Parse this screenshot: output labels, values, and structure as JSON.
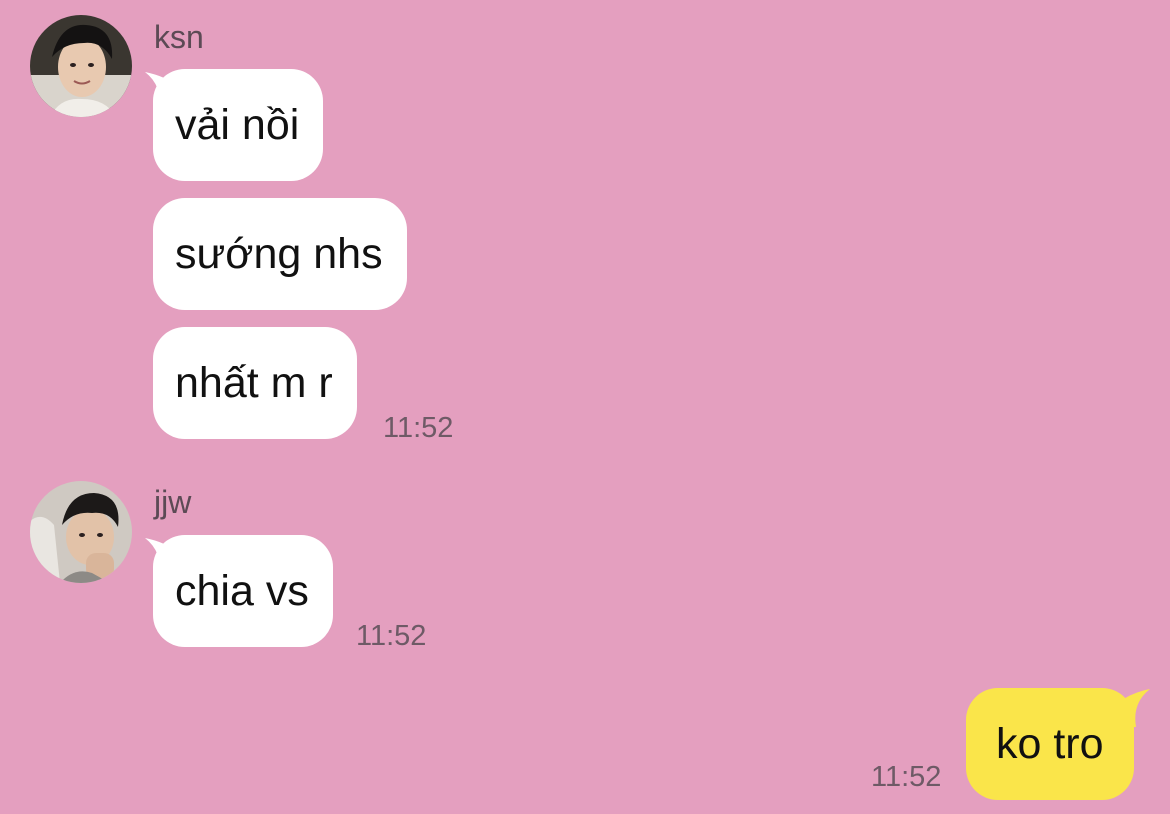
{
  "colors": {
    "background": "#e49fbf",
    "incoming_bubble": "#ffffff",
    "outgoing_bubble": "#fae54a",
    "secondary_text": "#6e5a66"
  },
  "groups": [
    {
      "sender": "ksn",
      "avatar_icon": "profile-photo-avatar",
      "messages": [
        "vải nồi",
        "sướng nhs",
        "nhất m r"
      ],
      "time": "11:52"
    },
    {
      "sender": "jjw",
      "avatar_icon": "profile-photo-avatar",
      "messages": [
        "chia vs"
      ],
      "time": "11:52"
    }
  ],
  "outgoing": {
    "messages": [
      "ko tro"
    ],
    "time": "11:52"
  }
}
